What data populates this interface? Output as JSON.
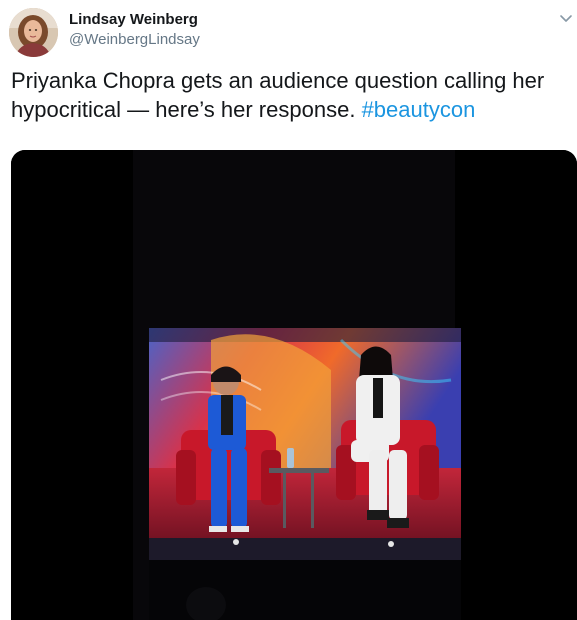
{
  "author": {
    "name": "Lindsay Weinberg",
    "handle": "@WeinbergLindsay"
  },
  "tweet": {
    "text_before": "Priyanka Chopra gets an audience question calling her hypocritical — here’s her response.",
    "hashtag": "#beautycon"
  },
  "icons": {
    "menu": "chevron-down-icon"
  },
  "colors": {
    "hashtag": "#1b95e0",
    "handle": "#657786",
    "text": "#14171a"
  }
}
